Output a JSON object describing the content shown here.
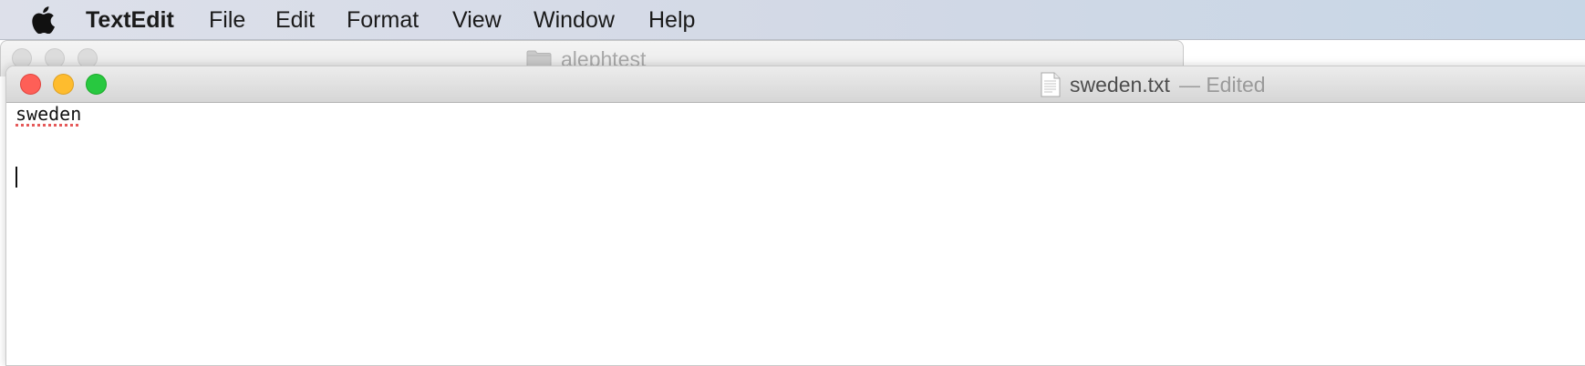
{
  "menubar": {
    "app_name": "TextEdit",
    "items": [
      {
        "label": "File"
      },
      {
        "label": "Edit"
      },
      {
        "label": "Format"
      },
      {
        "label": "View"
      },
      {
        "label": "Window"
      },
      {
        "label": "Help"
      }
    ]
  },
  "background_window": {
    "title": "alephtest",
    "icon": "folder-icon"
  },
  "document_window": {
    "filename": "sweden.txt",
    "status": "— Edited",
    "icon": "text-document-icon",
    "traffic_lights": {
      "close_color": "#fe5f57",
      "minimize_color": "#febc2e",
      "zoom_color": "#28c840"
    }
  },
  "document": {
    "lines": [
      "sweden",
      "",
      ""
    ],
    "spellcheck_underline_color": "#e55a5a"
  }
}
